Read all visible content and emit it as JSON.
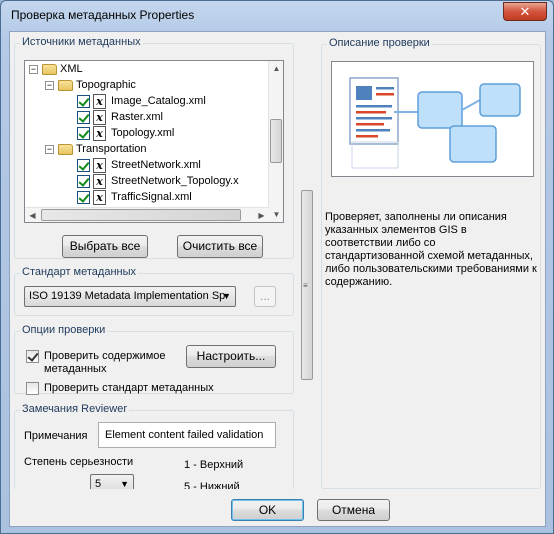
{
  "window": {
    "title": "Проверка метаданных Properties",
    "close_glyph": "✕"
  },
  "metadata_sources": {
    "group_title": "Источники метаданных",
    "tree": [
      {
        "label": "XML",
        "type": "folder",
        "expander": "−",
        "checked": false
      },
      {
        "label": "Topographic",
        "type": "folder",
        "expander": "−",
        "checked": false
      },
      {
        "label": "Image_Catalog.xml",
        "type": "file",
        "checked": true
      },
      {
        "label": "Raster.xml",
        "type": "file",
        "checked": true
      },
      {
        "label": "Topology.xml",
        "type": "file",
        "checked": true
      },
      {
        "label": "Transportation",
        "type": "folder",
        "expander": "−",
        "checked": false
      },
      {
        "label": "StreetNetwork.xml",
        "type": "file",
        "checked": true
      },
      {
        "label": "StreetNetwork_Topology.x",
        "type": "file",
        "checked": true
      },
      {
        "label": "TrafficSignal.xml",
        "type": "file",
        "checked": true
      }
    ],
    "select_all_label": "Выбрать все",
    "clear_all_label": "Очистить все"
  },
  "metadata_standard": {
    "group_title": "Стандарт метаданных",
    "selected": "ISO 19139 Metadata Implementation Sp",
    "browse_label": "..."
  },
  "check_options": {
    "group_title": "Опции проверки",
    "check_content_label": "Проверить  содержимое метаданных",
    "check_content_checked": true,
    "configure_label": "Настроить...",
    "check_standard_label": "Проверить стандарт метаданных",
    "check_standard_checked": false
  },
  "reviewer": {
    "group_title": "Замечания Reviewer",
    "notes_label": "Примечания",
    "notes_value": "Element content failed validation",
    "severity_label": "Степень серьезности",
    "severity_value": "5",
    "severity_high": "1 - Верхний",
    "severity_low": "5 - Нижний"
  },
  "description": {
    "group_title": "Описание проверки",
    "text": "Проверяет, заполнены ли описания указанных элементов GIS в соответствии либо со стандартизованной схемой метаданных, либо пользовательскими требованиями к содержанию."
  },
  "footer": {
    "ok_label": "OK",
    "cancel_label": "Отмена"
  },
  "colors": {
    "accent_blue": "#4f81bd",
    "doc_red": "#d9472b",
    "window_frame": "#aac1e0"
  }
}
